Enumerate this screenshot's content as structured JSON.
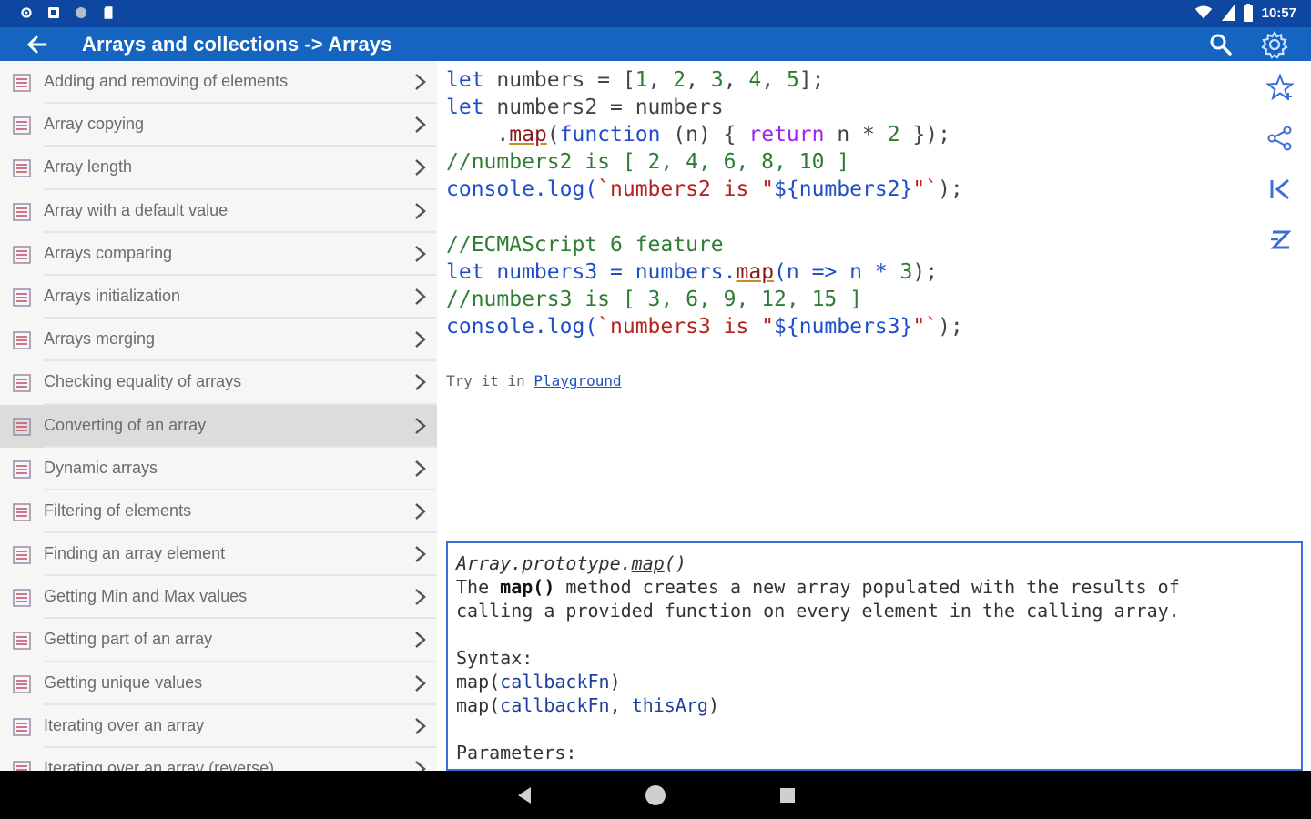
{
  "status_bar": {
    "time": "10:57",
    "icons": [
      "settings-icon",
      "notification-icon",
      "circle-icon",
      "sd-card-icon",
      "wifi-icon",
      "signal-icon",
      "battery-icon"
    ]
  },
  "app_bar": {
    "title": "Arrays and collections -> Arrays",
    "icons": [
      "back-arrow-icon",
      "search-icon",
      "settings-icon"
    ]
  },
  "sidebar": {
    "items": [
      {
        "label": "Adding and removing of elements"
      },
      {
        "label": "Array copying"
      },
      {
        "label": "Array length"
      },
      {
        "label": "Array with a default value"
      },
      {
        "label": "Arrays comparing"
      },
      {
        "label": "Arrays initialization"
      },
      {
        "label": "Arrays merging"
      },
      {
        "label": "Checking equality of arrays"
      },
      {
        "label": "Converting of an array"
      },
      {
        "label": "Dynamic arrays"
      },
      {
        "label": "Filtering of elements"
      },
      {
        "label": "Finding an array element"
      },
      {
        "label": "Getting Min and Max values"
      },
      {
        "label": "Getting part of an array"
      },
      {
        "label": "Getting unique values"
      },
      {
        "label": "Iterating over an array"
      },
      {
        "label": "Iterating over an array (reverse)"
      }
    ],
    "selected": "Converting of an array"
  },
  "code": {
    "l1": {
      "a": "let",
      "b": " numbers = [",
      "c": "1",
      "d": ", ",
      "e": "2",
      "f": ", ",
      "g": "3",
      "h": ", ",
      "i": "4",
      "j": ", ",
      "k": "5",
      "l": "];"
    },
    "l2": {
      "a": "let",
      "b": " numbers2 = numbers"
    },
    "l3": {
      "a": "    .",
      "b": "map",
      "c": "(",
      "d": "function",
      "e": " (n) { ",
      "f": "return",
      "g": " n * ",
      "h": "2",
      "i": " });"
    },
    "l4": "//numbers2 is [ 2, 4, 6, 8, 10 ]",
    "l5": {
      "a": "console.log(",
      "b": "`numbers2 is \"",
      "c": "${numbers2}",
      "d": "\"`",
      "e": ");"
    },
    "l6": "//ECMAScript 6 feature",
    "l7": {
      "a": "let",
      "b": " numbers3 = numbers.",
      "c": "map",
      "d": "(n => n * ",
      "e": "3",
      "f": ");"
    },
    "l8": "//numbers3 is [ 3, 6, 9, 12, 15 ]",
    "l9": {
      "a": "console.log(",
      "b": "`numbers3 is \"",
      "c": "${numbers3}",
      "d": "\"`",
      "e": ");"
    },
    "try_prefix": "Try it in ",
    "try_link": "Playground"
  },
  "actions": [
    "star-icon",
    "share-icon",
    "first-page-icon",
    "sort-az-icon"
  ],
  "doc": {
    "title_a": "Array.prototype.",
    "title_b": "map",
    "title_c": "()",
    "desc1_a": "The ",
    "desc1_b": "map()",
    "desc1_c": " method creates a new array populated with the results of",
    "desc2": "calling a provided function on every element in the calling array.",
    "syntax": "Syntax:",
    "syn1_a": "map(",
    "syn1_b": "callbackFn",
    "syn1_c": ")",
    "syn2_a": "map(",
    "syn2_b": "callbackFn",
    "syn2_c": ", ",
    "syn2_d": "thisArg",
    "syn2_e": ")",
    "params": "Parameters:"
  },
  "nav_bar": {
    "buttons": [
      "back-nav-icon",
      "home-nav-icon",
      "recents-nav-icon"
    ]
  },
  "colors": {
    "status_bar": "#0d47a1",
    "app_bar": "#1565c0",
    "keyword": "#1e4fc8",
    "number": "#2e7d32",
    "string": "#b5231f",
    "doc_border": "#3b6fd6"
  }
}
